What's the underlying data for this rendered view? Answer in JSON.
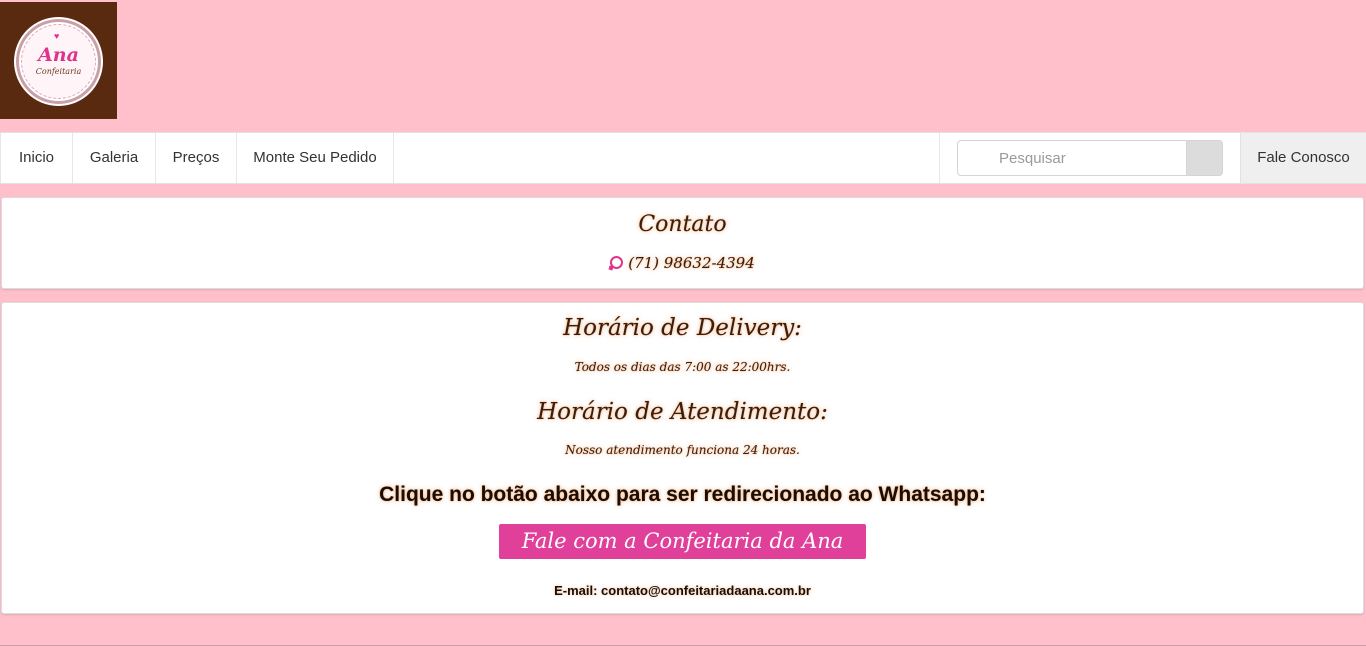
{
  "logo": {
    "heart": "♥",
    "name": "Ana",
    "subtitle": "Confeitaria"
  },
  "nav": {
    "items": [
      {
        "label": "Inicio"
      },
      {
        "label": "Galeria"
      },
      {
        "label": "Preços"
      },
      {
        "label": "Monte Seu Pedido"
      }
    ],
    "search_placeholder": "Pesquisar",
    "contact_label": "Fale Conosco"
  },
  "contact": {
    "title": "Contato",
    "phone": "(71) 98632-4394"
  },
  "hours": {
    "delivery_title": "Horário de Delivery:",
    "delivery_text": "Todos os dias das 7:00 as 22:00hrs.",
    "attend_title": "Horário de Atendimento:",
    "attend_text": "Nosso atendimento funciona 24 horas.",
    "redirect_text": "Clique no botão abaixo para ser redirecionado ao Whatsapp:",
    "button_label": "Fale com a Confeitaria da Ana",
    "email": "E-mail: contato@confeitariadaana.com.br"
  },
  "colors": {
    "page_background": "#ffc0cb",
    "logo_background": "#5a2a10",
    "brand_pink": "#e0409a",
    "text_brown": "#3a1d0d",
    "glow": "#e68c46"
  },
  "icons": {
    "phone": "whatsapp-icon",
    "search": "search-icon"
  }
}
